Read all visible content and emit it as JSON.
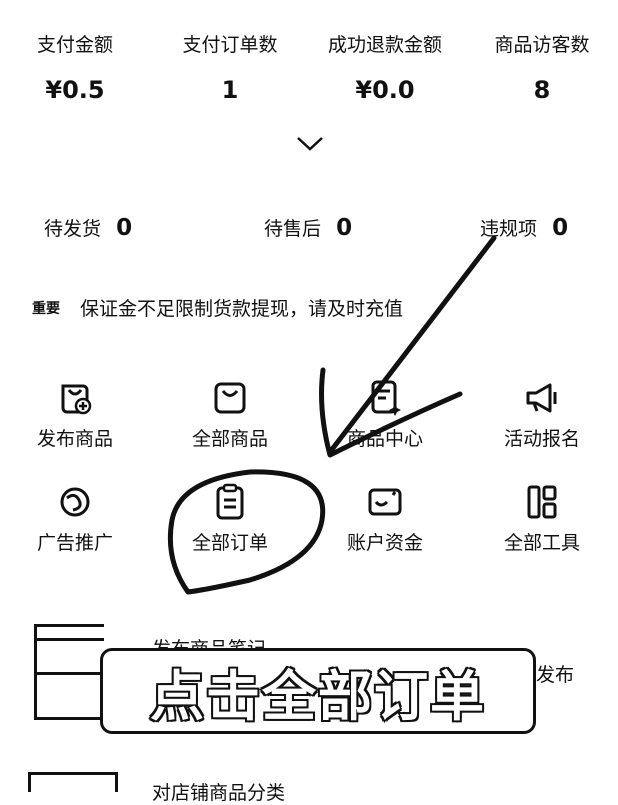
{
  "stats": [
    {
      "label": "支付金额",
      "value": "¥0.5"
    },
    {
      "label": "支付订单数",
      "value": "1"
    },
    {
      "label": "成功退款金额",
      "value": "¥0.0"
    },
    {
      "label": "商品访客数",
      "value": "8"
    }
  ],
  "expand_icon": "chevron-down-icon",
  "pending": [
    {
      "label": "待发货",
      "value": "0"
    },
    {
      "label": "待售后",
      "value": "0"
    },
    {
      "label": "违规项",
      "value": "0"
    }
  ],
  "notice": {
    "badge": "重要",
    "text": "保证金不足限制货款提现，请及时充值"
  },
  "tools": [
    {
      "label": "发布商品",
      "icon": "add-product-icon"
    },
    {
      "label": "全部商品",
      "icon": "bag-icon"
    },
    {
      "label": "商品中心",
      "icon": "sparkle-doc-icon"
    },
    {
      "label": "活动报名",
      "icon": "megaphone-icon"
    },
    {
      "label": "广告推广",
      "icon": "swirl-icon"
    },
    {
      "label": "全部订单",
      "icon": "clipboard-icon"
    },
    {
      "label": "账户资金",
      "icon": "wallet-icon"
    },
    {
      "label": "全部工具",
      "icon": "grid-icon"
    }
  ],
  "list": [
    {
      "title": "发布商品笔记",
      "action": "发布"
    },
    {
      "title": "对店铺商品分类"
    }
  ],
  "overlay": {
    "banner_text": "点击全部订单"
  }
}
